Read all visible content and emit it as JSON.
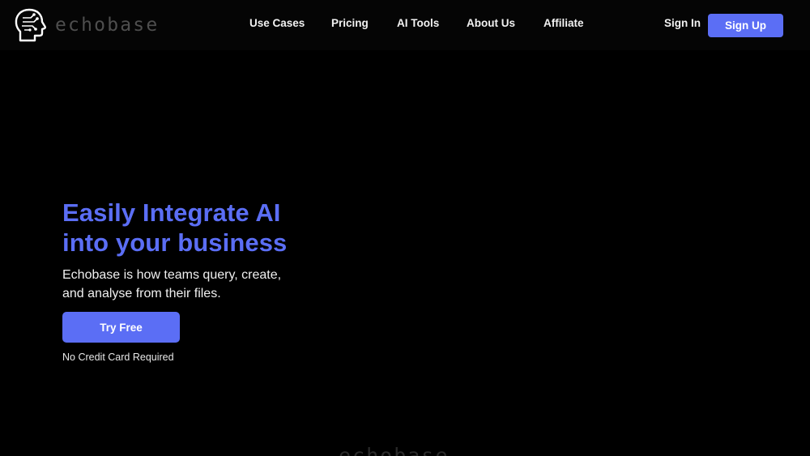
{
  "brand": {
    "name": "echobase"
  },
  "nav": {
    "links": [
      "Use Cases",
      "Pricing",
      "AI Tools",
      "About Us",
      "Affiliate"
    ],
    "sign_in": "Sign In",
    "sign_up": "Sign Up"
  },
  "hero": {
    "title_line1": "Easily Integrate AI",
    "title_line2": "into your business",
    "subtitle": "Echobase is how teams query, create, and analyse from their files.",
    "cta": "Try Free",
    "note": "No Credit Card Required"
  },
  "footer_watermark": "echobase",
  "colors": {
    "accent": "#5b6ef5",
    "background": "#000000",
    "logo_text": "#4e4e4e"
  }
}
